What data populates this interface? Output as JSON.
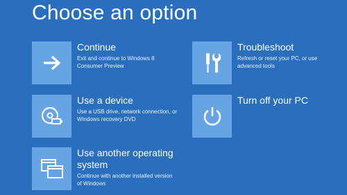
{
  "page": {
    "title": "Choose an option"
  },
  "options": [
    {
      "title": "Continue",
      "description_lines": [
        "Exit and continue to Windows 8",
        "Consumer Preview"
      ],
      "icon": "arrow-right-icon"
    },
    {
      "title": "Use a device",
      "description_lines": [
        "Use a USB drive, network connection, or",
        "Windows recovery DVD"
      ],
      "icon": "disc-device-icon"
    },
    {
      "title_lines": [
        "Use another operating",
        "system"
      ],
      "description_lines": [
        "Continue with another installed version",
        "of Windows"
      ],
      "icon": "windows-stack-icon"
    },
    {
      "title": "Troubleshoot",
      "description_lines": [
        "Refresh or reset your PC, or use",
        "advanced tools"
      ],
      "icon": "tools-icon"
    },
    {
      "title": "Turn off your PC",
      "description_lines": [],
      "icon": "power-icon"
    }
  ],
  "colors": {
    "background": "#2a6fbd",
    "tile": "#66a4e3",
    "text": "#ffffff"
  }
}
